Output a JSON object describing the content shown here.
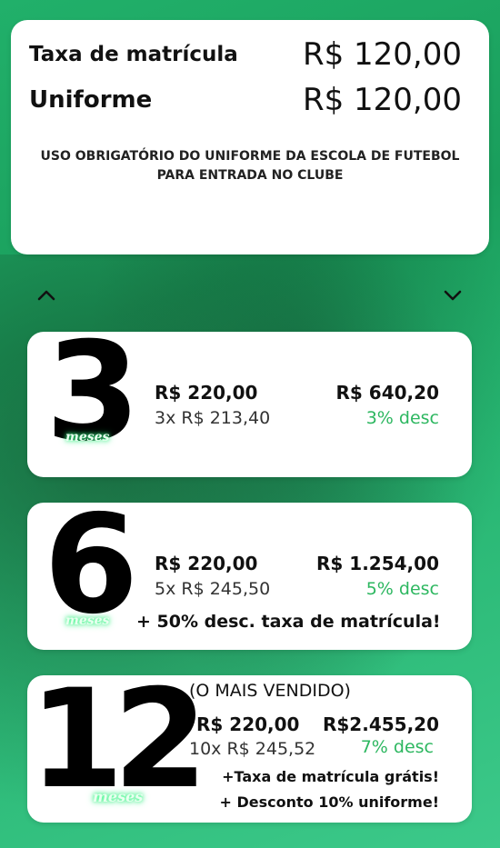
{
  "fees": {
    "enrollment_label": "Taxa de matrícula",
    "enrollment_value": "R$ 120,00",
    "uniform_label": "Uniforme",
    "uniform_value": "R$ 120,00",
    "note_line1": "USO OBRIGATÓRIO DO UNIFORME DA ESCOLA DE FUTEBOL",
    "note_line2": "PARA ENTRADA NO CLUBE"
  },
  "plans": [
    {
      "number": "3",
      "unit": "meses",
      "monthly": "R$ 220,00",
      "installments": "3x R$ 213,40",
      "total": "R$ 640,20",
      "discount": "3% desc"
    },
    {
      "number": "6",
      "unit": "meses",
      "monthly": "R$ 220,00",
      "installments": "5x R$ 245,50",
      "total": "R$ 1.254,00",
      "discount": "5% desc",
      "extra": "+ 50% desc. taxa de matrícula!"
    },
    {
      "number": "12",
      "unit": "meses",
      "tag": "(O MAIS VENDIDO)",
      "monthly": "R$ 220,00",
      "installments": "10x R$ 245,52",
      "total": "R$2.455,20",
      "discount": "7% desc",
      "extra1": "+Taxa de matrícula grátis!",
      "extra2": "+ Desconto 10% uniforme!"
    }
  ],
  "colors": {
    "background": "#21b06a",
    "discount": "#2db760",
    "card": "#ffffff"
  },
  "icons": {
    "up": "chevron-up-icon",
    "down": "chevron-down-icon"
  }
}
